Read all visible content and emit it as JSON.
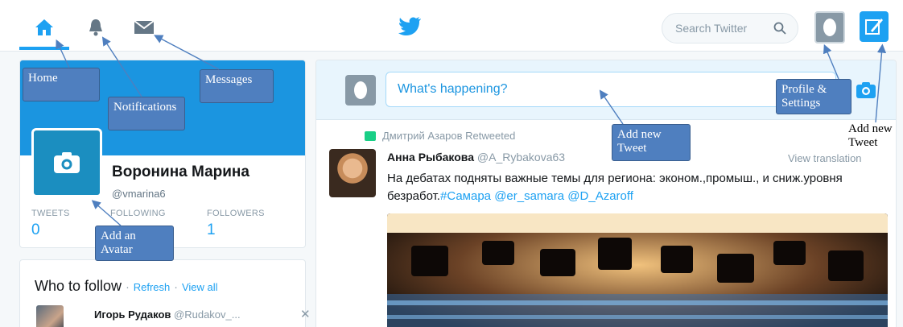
{
  "nav": {
    "search_placeholder": "Search Twitter"
  },
  "profile": {
    "name": "Воронина Марина",
    "handle": "@vmarina6",
    "stats": [
      {
        "label": "TWEETS",
        "value": "0"
      },
      {
        "label": "FOLLOWING",
        "value": ""
      },
      {
        "label": "FOLLOWERS",
        "value": "1"
      }
    ]
  },
  "who_to_follow": {
    "title": "Who to follow",
    "separator": "·",
    "refresh": "Refresh",
    "view_all": "View all",
    "suggestion": {
      "name": "Игорь Рудаков",
      "handle": "@Rudakov_..."
    },
    "close": "✕"
  },
  "compose": {
    "placeholder": "What's happening?"
  },
  "tweet": {
    "retweeted_by": "Дмитрий Азаров Retweeted",
    "author": "Анна Рыбакова",
    "handle": "@A_Rybakova63",
    "translate": "View translation",
    "text_part1": "На дебатах подняты важные темы для региона: эконом.,промыш., и сниж.уровня безработ.",
    "hashtag": "#Самара",
    "mention1": "@er_samara",
    "mention2": "@D_Azaroff"
  },
  "annotations": {
    "home": "Home",
    "notifications": "Notifications",
    "messages": "Messages",
    "add_tweet": "Add new Tweet",
    "profile_settings": "Profile & Settings",
    "add_new_tweet_right": "Add new Tweet",
    "add_avatar": "Add an Avatar"
  },
  "colors": {
    "brand": "#1da1f2",
    "banner": "#1b95e0",
    "callout": "#4f7fbf"
  }
}
